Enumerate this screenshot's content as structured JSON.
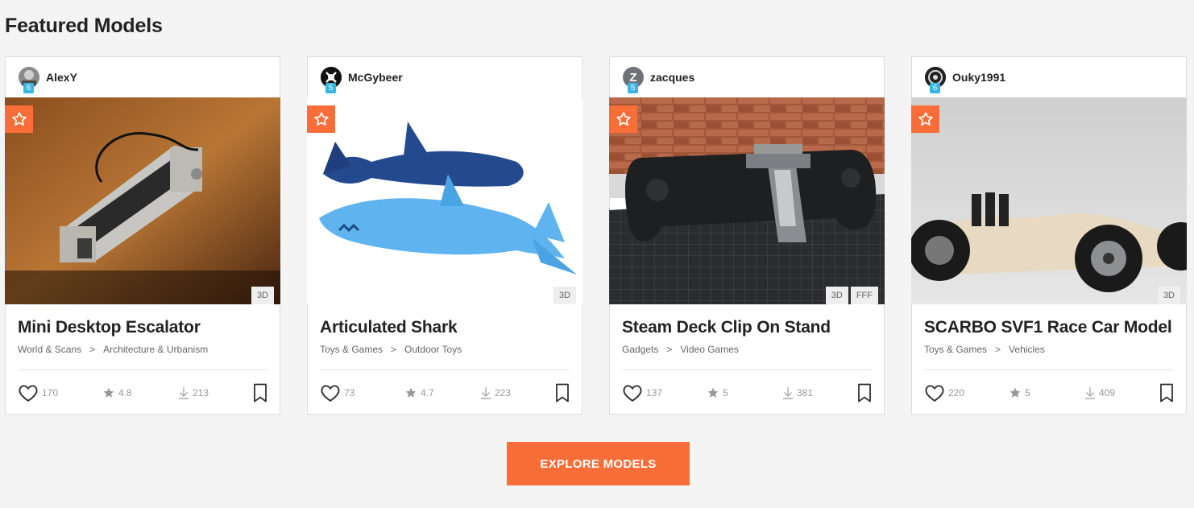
{
  "section": {
    "title": "Featured Models"
  },
  "cards": [
    {
      "author": "AlexY",
      "level": "6",
      "avatar_initial": "",
      "title": "Mini Desktop Escalator",
      "category": "World & Scans",
      "subcategory": "Architecture & Urbanism",
      "likes": "170",
      "rating": "4.8",
      "downloads": "213",
      "tags": [
        "3D"
      ],
      "separator": ">"
    },
    {
      "author": "McGybeer",
      "level": "5",
      "avatar_initial": "",
      "title": "Articulated Shark",
      "category": "Toys & Games",
      "subcategory": "Outdoor Toys",
      "likes": "73",
      "rating": "4.7",
      "downloads": "223",
      "tags": [
        "3D"
      ],
      "separator": ">"
    },
    {
      "author": "zacques",
      "level": "5",
      "avatar_initial": "Z",
      "title": "Steam Deck Clip On Stand",
      "category": "Gadgets",
      "subcategory": "Video Games",
      "likes": "137",
      "rating": "5",
      "downloads": "381",
      "tags": [
        "3D",
        "FFF"
      ],
      "separator": ">"
    },
    {
      "author": "Ouky1991",
      "level": "6",
      "avatar_initial": "",
      "title": "SCARBO SVF1 Race Car Model",
      "category": "Toys & Games",
      "subcategory": "Vehicles",
      "likes": "220",
      "rating": "5",
      "downloads": "409",
      "tags": [
        "3D"
      ],
      "separator": ">"
    }
  ],
  "explore_button": {
    "label": "EXPLORE MODELS"
  },
  "colors": {
    "accent": "#f96e38",
    "level_badge": "#35b6e3"
  },
  "icons": {
    "staff_pick": "star-outline-icon",
    "like": "heart-icon",
    "rating": "star-icon",
    "download": "download-icon",
    "bookmark": "bookmark-icon"
  }
}
